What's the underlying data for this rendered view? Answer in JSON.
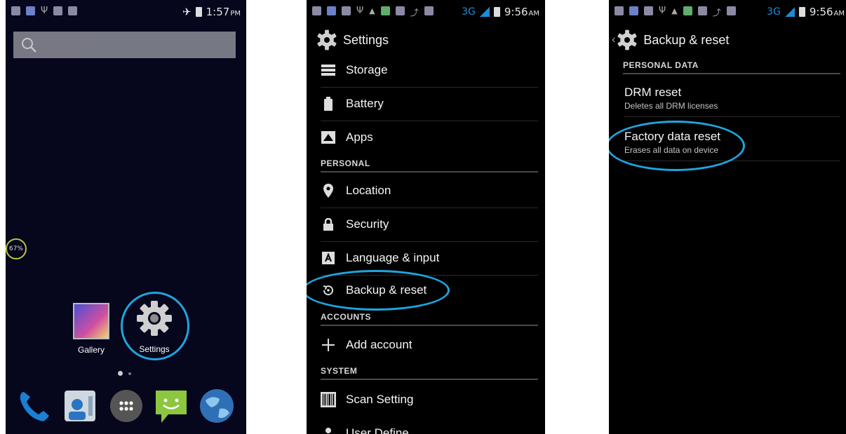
{
  "home": {
    "status_time": "1:57",
    "status_ampm": "PM",
    "battery_percent": "67%",
    "apps": [
      {
        "label": "Gallery",
        "icon": "gallery-icon"
      },
      {
        "label": "Settings",
        "icon": "gear-icon"
      }
    ],
    "dock": [
      "phone-icon",
      "contacts-icon",
      "app-drawer-icon",
      "messaging-icon",
      "browser-icon"
    ],
    "page_indicator": {
      "pages": 2,
      "current": 1
    }
  },
  "settings": {
    "status_network": "3G",
    "status_time": "9:56",
    "status_ampm": "AM",
    "title": "Settings",
    "items": [
      {
        "label": "Storage",
        "icon": "storage-icon"
      },
      {
        "label": "Battery",
        "icon": "battery-icon"
      },
      {
        "label": "Apps",
        "icon": "apps-icon"
      }
    ],
    "personal_header": "PERSONAL",
    "personal_items": [
      {
        "label": "Location",
        "icon": "location-icon"
      },
      {
        "label": "Security",
        "icon": "lock-icon"
      },
      {
        "label": "Language & input",
        "icon": "language-icon"
      },
      {
        "label": "Backup & reset",
        "icon": "backup-icon"
      }
    ],
    "accounts_header": "ACCOUNTS",
    "accounts_items": [
      {
        "label": "Add account",
        "icon": "plus-icon"
      }
    ],
    "system_header": "SYSTEM",
    "system_items": [
      {
        "label": "Scan Setting",
        "icon": "barcode-icon"
      },
      {
        "label": "User Define",
        "icon": "user-icon"
      }
    ]
  },
  "backup": {
    "status_network": "3G",
    "status_time": "9:56",
    "status_ampm": "AM",
    "title": "Backup & reset",
    "header": "PERSONAL DATA",
    "items": [
      {
        "title": "DRM reset",
        "subtitle": "Deletes all DRM licenses"
      },
      {
        "title": "Factory data reset",
        "subtitle": "Erases all data on device"
      }
    ]
  },
  "colors": {
    "highlight_ring": "#1ea5df",
    "home_bg": "#06061c"
  }
}
